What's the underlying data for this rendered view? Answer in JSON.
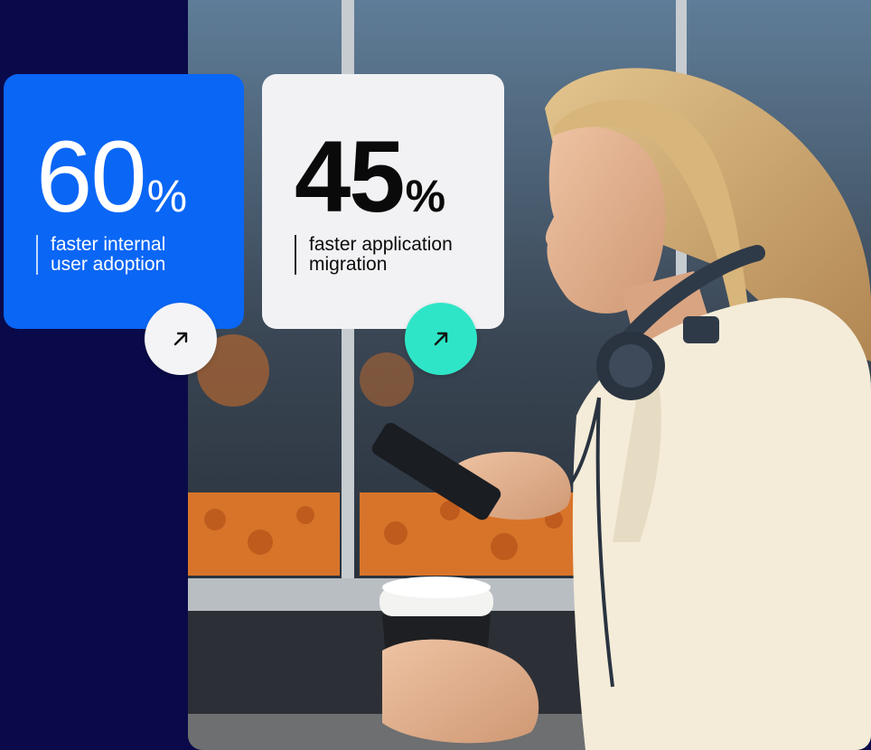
{
  "stats": [
    {
      "value": "60",
      "unit": "%",
      "description": "faster internal\nuser adoption",
      "arrow_icon": "arrow-up-right-icon"
    },
    {
      "value": "45",
      "unit": "%",
      "description": "faster application\nmigration",
      "arrow_icon": "arrow-up-right-icon"
    }
  ],
  "colors": {
    "background": "#0a0a4a",
    "card_blue": "#0a66f5",
    "card_white": "#f2f2f4",
    "button_light": "#f4f4f6",
    "button_mint": "#2ee6c7"
  }
}
